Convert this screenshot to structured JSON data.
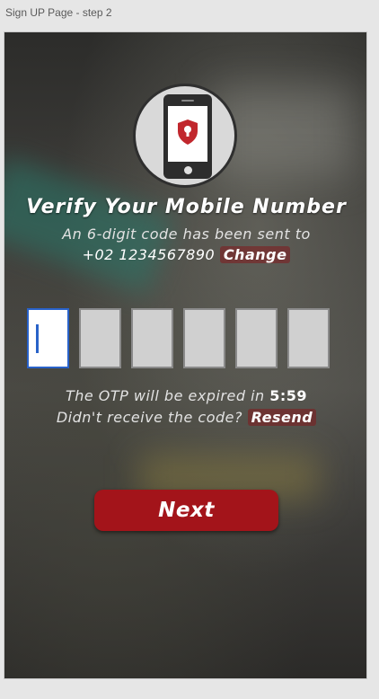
{
  "window": {
    "title": "Sign UP Page - step 2"
  },
  "logo": {
    "icon": "phone-shield-lock-icon",
    "accent_color": "#c1272d"
  },
  "verify": {
    "heading": "Verify Your Mobile Number",
    "subtitle": "An 6-digit code has been sent to",
    "phone_number": "+02 1234567890",
    "change_label": "Change"
  },
  "otp": {
    "digits": [
      "",
      "",
      "",
      "",
      "",
      ""
    ],
    "active_index": 0,
    "active_color": "#2962c9"
  },
  "timer": {
    "label": "The OTP will be expired in",
    "value": "5:59"
  },
  "resend": {
    "question": "Didn't receive the code?",
    "label": "Resend"
  },
  "actions": {
    "next_label": "Next",
    "next_color": "#a3141a"
  }
}
